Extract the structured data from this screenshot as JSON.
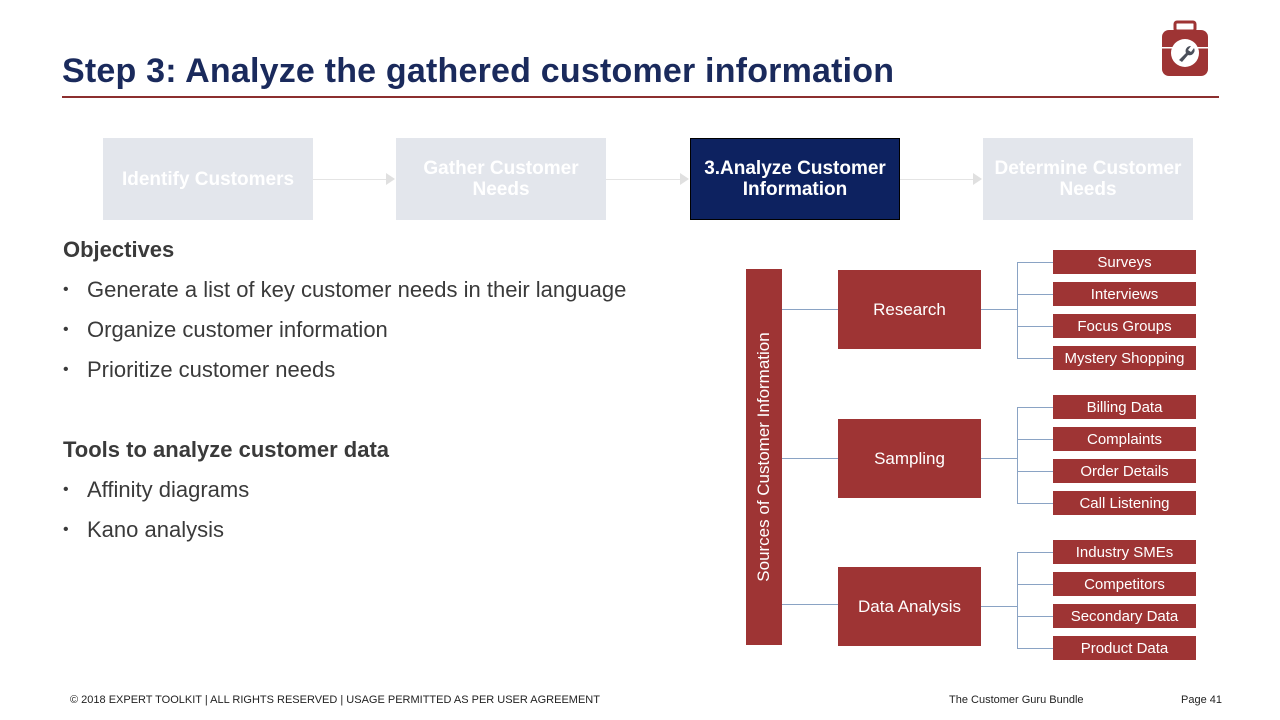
{
  "header": {
    "title": "Step 3: Analyze the gathered customer information",
    "logo_icon": "toolbox-wrench-icon",
    "accent_color": "#8c2f2f",
    "title_color": "#1a2a5c"
  },
  "process": {
    "steps": [
      {
        "label": "Identify Customers",
        "active": false
      },
      {
        "label": "Gather Customer Needs",
        "active": false
      },
      {
        "label": "3.Analyze Customer Information",
        "active": true
      },
      {
        "label": "Determine Customer Needs",
        "active": false
      }
    ],
    "active_color": "#0d2260",
    "inactive_color": "#e3e6ec"
  },
  "objectives": {
    "heading": "Objectives",
    "items": [
      "Generate a list of key customer needs in their language",
      "Organize customer information",
      "Prioritize customer needs"
    ]
  },
  "tools": {
    "heading": "Tools to analyze customer data",
    "items": [
      "Affinity diagrams",
      "Kano analysis"
    ]
  },
  "diagram": {
    "root": "Sources of Customer Information",
    "box_color": "#9e3434",
    "categories": [
      {
        "label": "Research",
        "children": [
          "Surveys",
          "Interviews",
          "Focus Groups",
          "Mystery Shopping"
        ]
      },
      {
        "label": "Sampling",
        "children": [
          "Billing Data",
          "Complaints",
          "Order Details",
          "Call Listening"
        ]
      },
      {
        "label": "Data Analysis",
        "children": [
          "Industry SMEs",
          "Competitors",
          "Secondary Data",
          "Product Data"
        ]
      }
    ]
  },
  "footer": {
    "copyright": "© 2018 EXPERT TOOLKIT | ALL RIGHTS RESERVED | USAGE PERMITTED AS PER USER AGREEMENT",
    "bundle": "The Customer Guru Bundle",
    "page": "Page 41"
  }
}
